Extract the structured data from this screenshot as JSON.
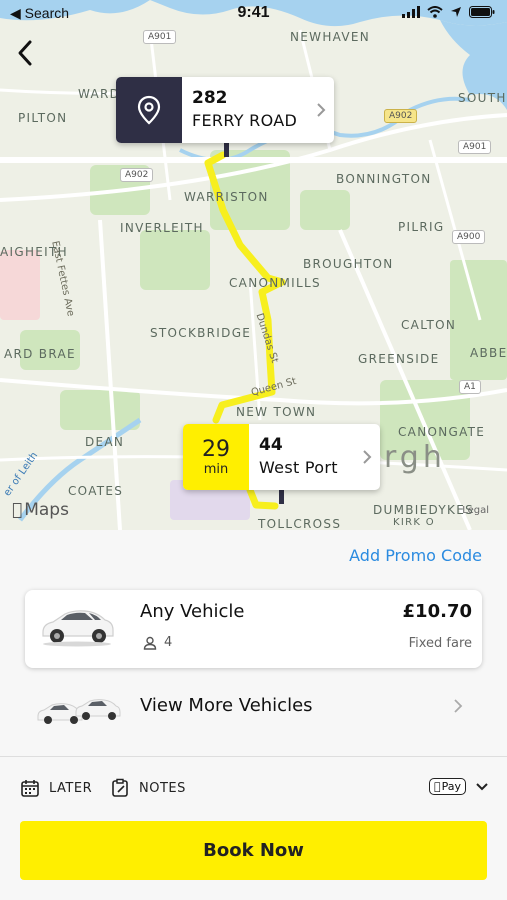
{
  "status_bar": {
    "back_app": "◀ Search",
    "time": "9:41"
  },
  "map": {
    "area_labels": [
      "NEWHAVEN",
      "WARD",
      "SOUTH",
      "PILTON",
      "BONNINGTON",
      "WARRISTON",
      "INVERLEITH",
      "PILRIG",
      "AIGHEITH",
      "BROUGHTON",
      "CANONMILLS",
      "STOCKBRIDGE",
      "CALTON",
      "ARD BRAE",
      "GREENSIDE",
      "ABBE",
      "NEW TOWN",
      "CANONGATE",
      "DEAN",
      "COATES",
      "DUMBIEDYKES",
      "TOLLCROSS",
      "KIRK O"
    ],
    "road_labels": [
      "East Fettes Ave",
      "Dundas St",
      "Queen St",
      "er of Leith"
    ],
    "shields": [
      "A901",
      "A902",
      "A902",
      "A901",
      "A900",
      "A1"
    ],
    "city_label": "rgh",
    "maps_logo": "Maps",
    "legal": "Legal"
  },
  "pickup": {
    "number": "282",
    "street": "FERRY ROAD"
  },
  "dropoff": {
    "eta_value": "29",
    "eta_unit": "min",
    "number": "44",
    "street": "West Port"
  },
  "booking": {
    "promo_link": "Add Promo Code",
    "vehicle": {
      "name": "Any Vehicle",
      "seats": "4",
      "price": "£10.70",
      "fare_type": "Fixed fare"
    },
    "more_vehicles": "View More Vehicles",
    "options": {
      "later": "LATER",
      "notes": "NOTES",
      "payment": "Pay"
    },
    "book_button": "Book Now"
  },
  "colors": {
    "accent_yellow": "#ffef00",
    "pin_dark": "#2f2f45",
    "link_blue": "#2b8be0",
    "route": "#f7ef1e"
  }
}
